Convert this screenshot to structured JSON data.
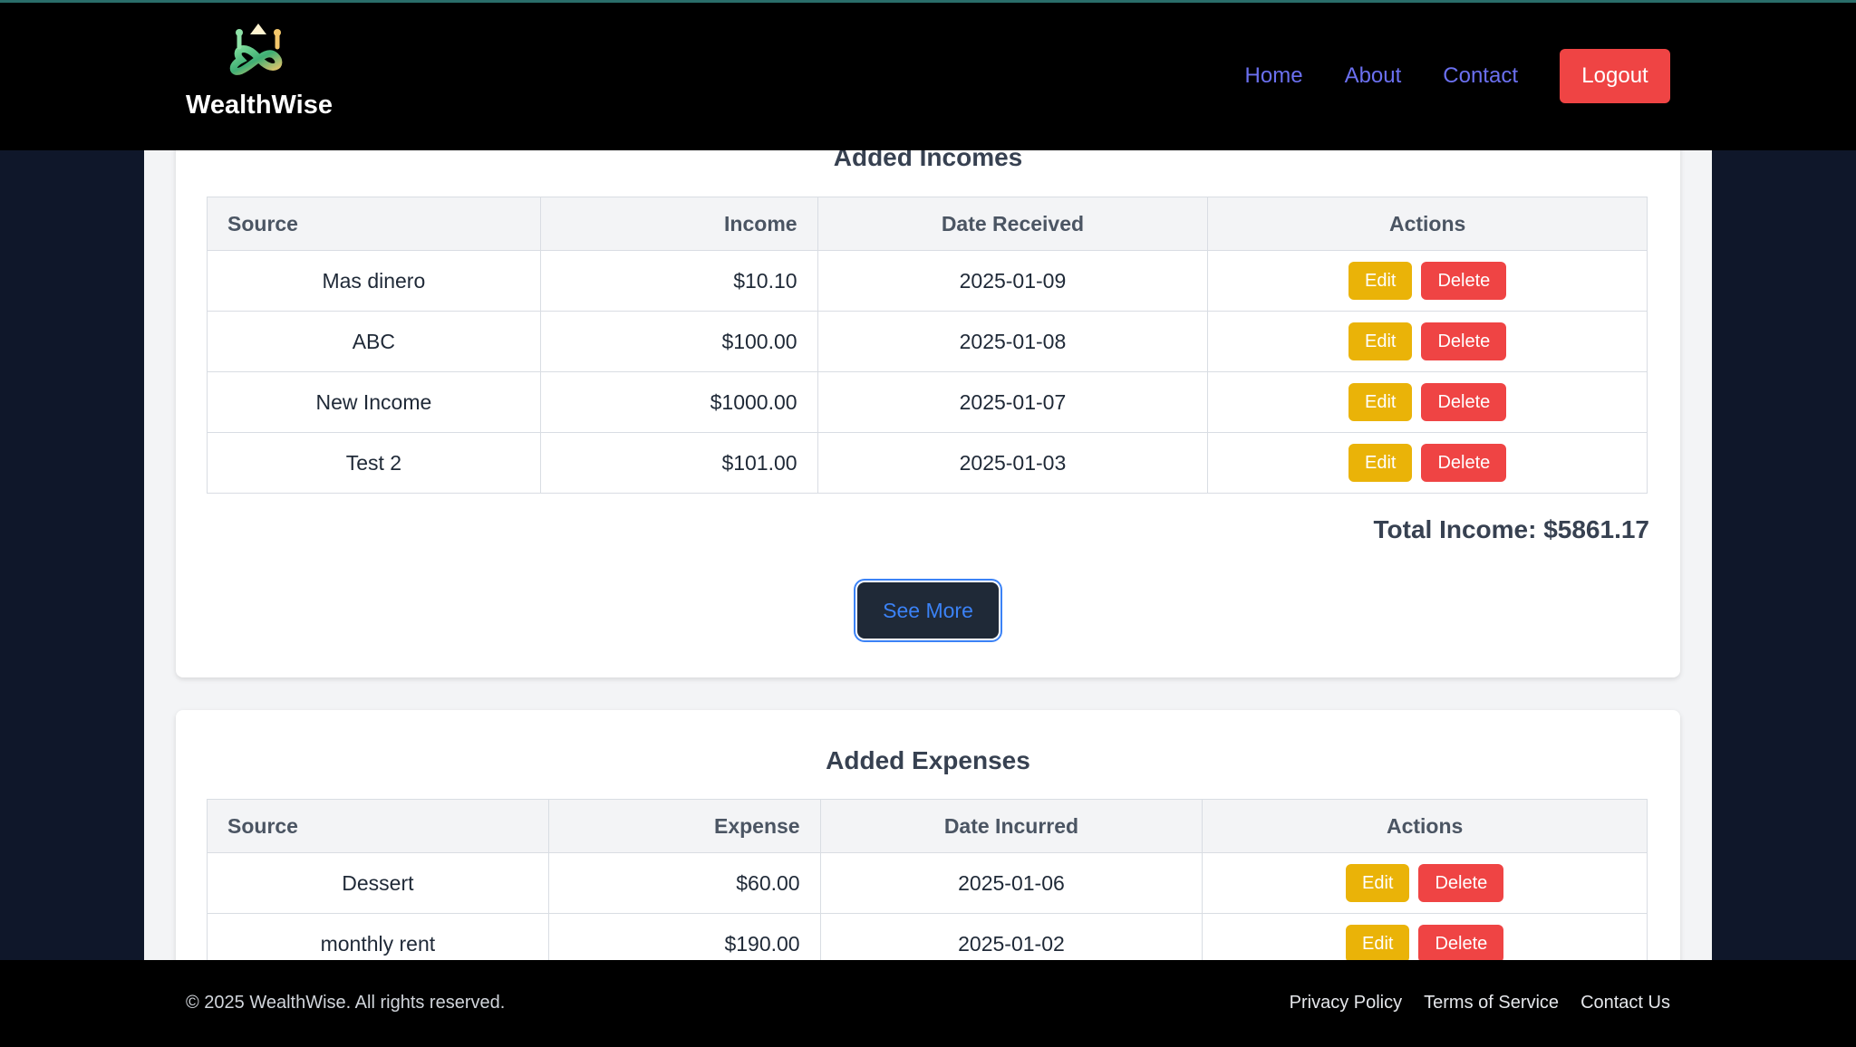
{
  "header": {
    "brand": "WealthWise",
    "nav": [
      {
        "label": "Home"
      },
      {
        "label": "About"
      },
      {
        "label": "Contact"
      }
    ],
    "logout_label": "Logout"
  },
  "incomes": {
    "title": "Added Incomes",
    "columns": [
      "Source",
      "Income",
      "Date Received",
      "Actions"
    ],
    "rows": [
      {
        "source": "Mas dinero",
        "amount": "$10.10",
        "date": "2025-01-09"
      },
      {
        "source": "ABC",
        "amount": "$100.00",
        "date": "2025-01-08"
      },
      {
        "source": "New Income",
        "amount": "$1000.00",
        "date": "2025-01-07"
      },
      {
        "source": "Test 2",
        "amount": "$101.00",
        "date": "2025-01-03"
      }
    ],
    "total": "Total Income: $5861.17",
    "see_more_label": "See More"
  },
  "expenses": {
    "title": "Added Expenses",
    "columns": [
      "Source",
      "Expense",
      "Date Incurred",
      "Actions"
    ],
    "rows": [
      {
        "source": "Dessert",
        "amount": "$60.00",
        "date": "2025-01-06"
      },
      {
        "source": "monthly rent",
        "amount": "$190.00",
        "date": "2025-01-02"
      }
    ]
  },
  "actions": {
    "edit_label": "Edit",
    "delete_label": "Delete"
  },
  "footer": {
    "copyright": "© 2025 WealthWise. All rights reserved.",
    "links": [
      {
        "label": "Privacy Policy"
      },
      {
        "label": "Terms of Service"
      },
      {
        "label": "Contact Us"
      }
    ]
  },
  "colors": {
    "header_bg": "#000000",
    "page_bg": "#0f172a",
    "nav_link": "#6b70f0",
    "logout_bg": "#ef4444",
    "edit_bg": "#eab308",
    "delete_bg": "#ef4444",
    "see_more_text": "#3b82f6"
  },
  "icons": {
    "brand_logo": "infinity-arrow-logo"
  }
}
